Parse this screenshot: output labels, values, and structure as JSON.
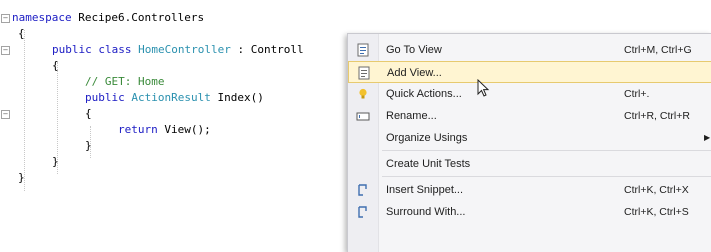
{
  "editor": {
    "lines": [
      {
        "t": "namespace Recipe6.Controllers"
      },
      {
        "t": "{"
      },
      {
        "k": "public class",
        "ty": "HomeController",
        "r": " : Controll"
      },
      {
        "t": "{"
      },
      {
        "c": "// GET: Home"
      },
      {
        "k": "public",
        "ty": "ActionResult",
        "r": " Index()"
      },
      {
        "t": "{"
      },
      {
        "k": "return",
        "r": " View();"
      },
      {
        "t": "}"
      },
      {
        "t": "}"
      },
      {
        "t": "}"
      }
    ]
  },
  "context_menu": {
    "items": [
      {
        "label": "Go To View",
        "shortcut": "Ctrl+M, Ctrl+G",
        "icon": "go-to-view-icon"
      },
      {
        "label": "Add View...",
        "shortcut": "",
        "icon": "add-view-icon"
      },
      {
        "label": "Quick Actions...",
        "shortcut": "Ctrl+.",
        "icon": "lightbulb-icon"
      },
      {
        "label": "Rename...",
        "shortcut": "Ctrl+R, Ctrl+R",
        "icon": "rename-icon"
      },
      {
        "label": "Organize Usings",
        "shortcut": "",
        "icon": ""
      },
      {
        "label": "Create Unit Tests",
        "shortcut": "",
        "icon": ""
      },
      {
        "label": "Insert Snippet...",
        "shortcut": "Ctrl+K, Ctrl+X",
        "icon": "snippet-icon"
      },
      {
        "label": "Surround With...",
        "shortcut": "Ctrl+K, Ctrl+S",
        "icon": "surround-with-icon"
      }
    ],
    "hovered_index": 1,
    "submenu_index": 4,
    "colors": {
      "hover_bg": "#fff5d2",
      "hover_border": "#e7ca6f",
      "icon_blue": "#3f6fb0",
      "bulb": "#f2c12e"
    }
  }
}
